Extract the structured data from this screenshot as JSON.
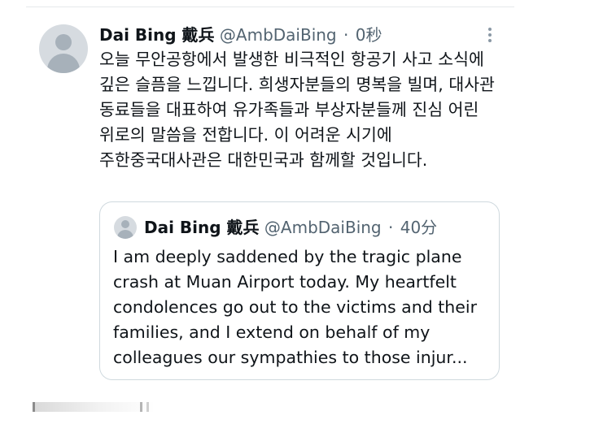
{
  "tweet": {
    "display_name": "Dai Bing 戴兵",
    "handle": "@AmbDaiBing",
    "separator": "·",
    "time": "0秒",
    "text": "오늘 무안공항에서 발생한 비극적인 항공기 사고 소식에 깊은 슬픔을 느낍니다. 희생자분들의 명복을 빌며, 대사관 동료들을 대표하여 유가족들과 부상자분들께 진심 어린 위로의 말씀을 전합니다. 이 어려운 시기에 주한중국대사관은 대한민국과 함께할 것입니다.",
    "more_icon": "more-vertical-icon",
    "avatar_icon": "default-avatar-icon"
  },
  "quoted": {
    "display_name": "Dai Bing 戴兵",
    "handle": "@AmbDaiBing",
    "separator": "·",
    "time": "40分",
    "text": "I am deeply saddened by the tragic plane crash at Muan Airport today. My heartfelt condolences go out to the victims and their families, and I extend on behalf of my colleagues our sympathies to those injur...",
    "avatar_icon": "default-avatar-icon"
  },
  "colors": {
    "text": "#0f1419",
    "secondary": "#536471",
    "border": "#cfd9de",
    "avatar_bg": "#d6dbe0",
    "avatar_fg": "#a7b1ba"
  }
}
